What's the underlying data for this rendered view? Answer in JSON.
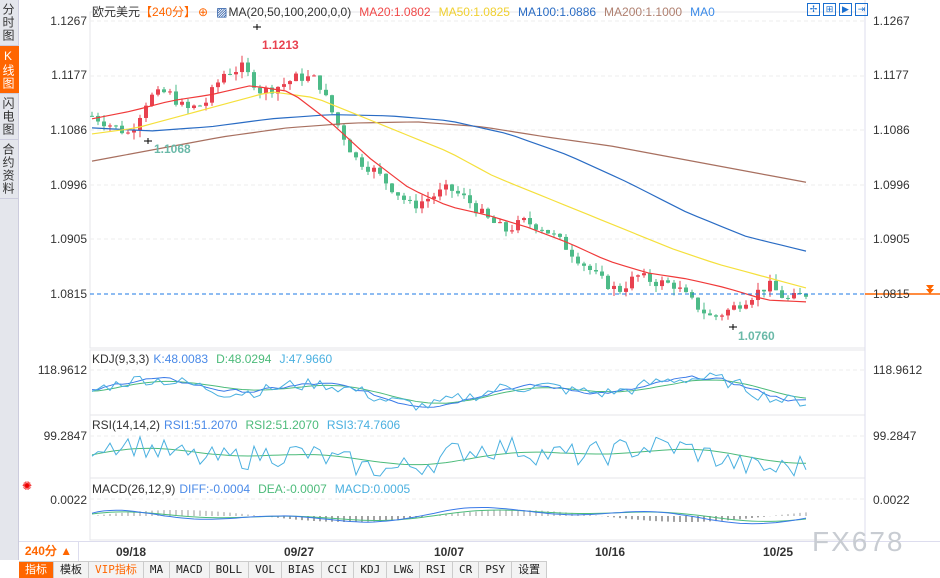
{
  "sidebar": {
    "tabs": [
      "分时图",
      "K线图",
      "闪电图",
      "合约资料"
    ],
    "active": 1
  },
  "header": {
    "symbol": "欧元美元",
    "period": "【240分】",
    "ma_label": "MA(20,50,100,200,0,0)",
    "ma20": "MA20:1.0802",
    "ma50": "MA50:1.0825",
    "ma100": "MA100:1.0886",
    "ma200": "MA200:1.1000",
    "ma0": "MA0"
  },
  "colors": {
    "up": "#e8414f",
    "down": "#4dbb88",
    "ma20": "#f03a3a",
    "ma50": "#f5e03c",
    "ma100": "#2a6cc4",
    "ma200": "#a87060",
    "current": "#1e78e6",
    "orange": "#f60"
  },
  "price_axis": [
    "1.1267",
    "1.1177",
    "1.1086",
    "1.0996",
    "1.0905",
    "1.0815"
  ],
  "current_price": "1.0815",
  "high_label": "1.1213",
  "low_label_1": "1.1068",
  "low_label_2": "1.0760",
  "kdj": {
    "title": "KDJ(9,3,3)",
    "k": "K:48.0083",
    "d": "D:48.0294",
    "j": "J:47.9660",
    "axis": "118.9612"
  },
  "rsi": {
    "title": "RSI(14,14,2)",
    "rsi1": "RSI1:51.2070",
    "rsi2": "RSI2:51.2070",
    "rsi3": "RSI3:74.7606",
    "axis": "99.2847"
  },
  "macd": {
    "title": "MACD(26,12,9)",
    "diff": "DIFF:-0.0004",
    "dea": "DEA:-0.0007",
    "macd": "MACD:0.0005",
    "axis": "0.0022"
  },
  "period_button": "240分 ▲",
  "x_ticks": [
    "09/18",
    "09/27",
    "10/07",
    "10/16",
    "10/25"
  ],
  "toolbar": [
    "指标",
    "模板",
    "VIP指标",
    "MA",
    "MACD",
    "BOLL",
    "VOL",
    "BIAS",
    "CCI",
    "KDJ",
    "LW&",
    "RSI",
    "CR",
    "PSY",
    "设置"
  ],
  "watermark": "FX678",
  "chart_data": {
    "type": "candlestick",
    "price_range": [
      1.0745,
      1.128
    ],
    "close_path": [
      1.111,
      1.1095,
      1.108,
      1.114,
      1.115,
      1.112,
      1.113,
      1.118,
      1.119,
      1.115,
      1.116,
      1.1175,
      1.117,
      1.11,
      1.104,
      1.102,
      1.099,
      1.096,
      1.0975,
      1.099,
      1.097,
      1.094,
      1.092,
      1.0935,
      1.0925,
      1.09,
      1.087,
      1.084,
      1.082,
      1.0845,
      1.0835,
      1.083,
      1.08,
      1.0775,
      1.079,
      1.081,
      1.083,
      1.0805,
      1.0815
    ],
    "ma20_path": [
      1.1105,
      1.1118,
      1.1135,
      1.1145,
      1.116,
      1.115,
      1.11,
      1.104,
      1.099,
      1.096,
      1.0945,
      1.0925,
      1.09,
      1.087,
      1.085,
      1.084,
      1.0825,
      1.0805,
      1.0802
    ],
    "ma50_path": [
      1.108,
      1.109,
      1.111,
      1.113,
      1.115,
      1.114,
      1.111,
      1.108,
      1.105,
      1.101,
      1.098,
      1.095,
      1.092,
      1.089,
      1.0865,
      1.0845,
      1.0825
    ],
    "ma100_path": [
      1.109,
      1.1085,
      1.1092,
      1.1105,
      1.1112,
      1.111,
      1.1102,
      1.108,
      1.1045,
      1.1,
      1.095,
      1.091,
      1.0886
    ],
    "ma200_path": [
      1.1035,
      1.1055,
      1.1075,
      1.109,
      1.1098,
      1.11,
      1.1092,
      1.1075,
      1.106,
      1.104,
      1.102,
      1.1
    ]
  }
}
